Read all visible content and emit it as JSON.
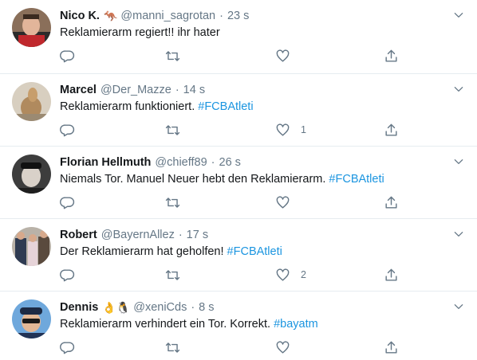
{
  "tweets": [
    {
      "name": "Nico K.",
      "emoji": "🦘",
      "handle": "@manni_sagrotan",
      "separator": "·",
      "time": "23 s",
      "text": "Reklamierarm regiert!! ihr hater",
      "hashtag": "",
      "like_count": ""
    },
    {
      "name": "Marcel",
      "emoji": "",
      "handle": "@Der_Mazze",
      "separator": "·",
      "time": "14 s",
      "text": "Reklamierarm funktioniert. ",
      "hashtag": "#FCBAtleti",
      "like_count": "1"
    },
    {
      "name": "Florian Hellmuth",
      "emoji": "",
      "handle": "@chieff89",
      "separator": "·",
      "time": "26 s",
      "text": "Niemals Tor. Manuel Neuer hebt den Reklamierarm. ",
      "hashtag": "#FCBAtleti",
      "like_count": ""
    },
    {
      "name": "Robert",
      "emoji": "",
      "handle": "@BayernAllez",
      "separator": "·",
      "time": "17 s",
      "text": "Der Reklamierarm hat geholfen! ",
      "hashtag": "#FCBAtleti",
      "like_count": "2"
    },
    {
      "name": "Dennis",
      "emoji": "👌🐧",
      "handle": "@xeniCds",
      "separator": "·",
      "time": "8 s",
      "text": "Reklamierarm verhindert ein Tor. Korrekt. ",
      "hashtag": "#bayatm",
      "like_count": ""
    }
  ],
  "colors": {
    "name": "#14171a",
    "secondary": "#657786",
    "hashtag": "#1b95e0",
    "divider": "#e6ecf0"
  },
  "icons": [
    "reply-icon",
    "retweet-icon",
    "like-icon",
    "share-icon",
    "caret-down-icon"
  ]
}
